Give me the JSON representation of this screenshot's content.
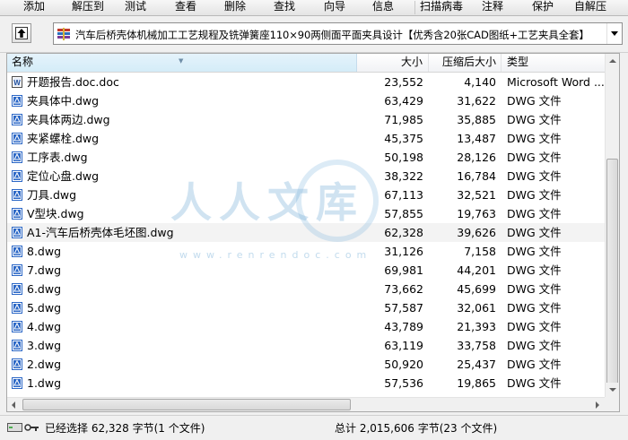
{
  "toolbar": {
    "buttons": [
      {
        "label": "添加"
      },
      {
        "label": "解压到"
      },
      {
        "label": "测试"
      },
      {
        "label": "查看"
      },
      {
        "label": "删除"
      },
      {
        "label": "查找"
      },
      {
        "label": "向导"
      },
      {
        "label": "信息"
      },
      {
        "label": "扫描病毒"
      },
      {
        "label": "注释"
      },
      {
        "label": "保护"
      },
      {
        "label": "自解压"
      }
    ]
  },
  "address": {
    "path": "汽车后桥壳体机械加工工艺规程及铣弹簧座110×90两侧面平面夹具设计【优秀含20张CAD图纸+工艺夹具全套】"
  },
  "columns": {
    "name": "名称",
    "size": "大小",
    "compressed": "压缩后大小",
    "type": "类型"
  },
  "files": [
    {
      "name": "开题报告.doc.doc",
      "size": "23,552",
      "compressed": "4,140",
      "type": "Microsoft Word ...",
      "icon": "word-doc-icon"
    },
    {
      "name": "夹具体中.dwg",
      "size": "63,429",
      "compressed": "31,622",
      "type": "DWG 文件",
      "icon": "dwg-file-icon"
    },
    {
      "name": "夹具体两边.dwg",
      "size": "71,985",
      "compressed": "35,885",
      "type": "DWG 文件",
      "icon": "dwg-file-icon"
    },
    {
      "name": "夹紧螺栓.dwg",
      "size": "45,375",
      "compressed": "13,487",
      "type": "DWG 文件",
      "icon": "dwg-file-icon"
    },
    {
      "name": "工序表.dwg",
      "size": "50,198",
      "compressed": "28,126",
      "type": "DWG 文件",
      "icon": "dwg-file-icon"
    },
    {
      "name": "定位心盘.dwg",
      "size": "38,322",
      "compressed": "16,784",
      "type": "DWG 文件",
      "icon": "dwg-file-icon"
    },
    {
      "name": "刀具.dwg",
      "size": "67,113",
      "compressed": "32,521",
      "type": "DWG 文件",
      "icon": "dwg-file-icon"
    },
    {
      "name": "V型块.dwg",
      "size": "57,855",
      "compressed": "19,763",
      "type": "DWG 文件",
      "icon": "dwg-file-icon"
    },
    {
      "name": "A1-汽车后桥壳体毛坯图.dwg",
      "size": "62,328",
      "compressed": "39,626",
      "type": "DWG 文件",
      "icon": "dwg-file-icon",
      "selected": true
    },
    {
      "name": "8.dwg",
      "size": "31,126",
      "compressed": "7,158",
      "type": "DWG 文件",
      "icon": "dwg-file-icon"
    },
    {
      "name": "7.dwg",
      "size": "69,981",
      "compressed": "44,201",
      "type": "DWG 文件",
      "icon": "dwg-file-icon"
    },
    {
      "name": "6.dwg",
      "size": "73,662",
      "compressed": "45,699",
      "type": "DWG 文件",
      "icon": "dwg-file-icon"
    },
    {
      "name": "5.dwg",
      "size": "57,587",
      "compressed": "32,061",
      "type": "DWG 文件",
      "icon": "dwg-file-icon"
    },
    {
      "name": "4.dwg",
      "size": "43,789",
      "compressed": "21,393",
      "type": "DWG 文件",
      "icon": "dwg-file-icon"
    },
    {
      "name": "3.dwg",
      "size": "63,119",
      "compressed": "33,758",
      "type": "DWG 文件",
      "icon": "dwg-file-icon"
    },
    {
      "name": "2.dwg",
      "size": "50,920",
      "compressed": "25,437",
      "type": "DWG 文件",
      "icon": "dwg-file-icon"
    },
    {
      "name": "1.dwg",
      "size": "57,536",
      "compressed": "19,865",
      "type": "DWG 文件",
      "icon": "dwg-file-icon"
    }
  ],
  "watermark": {
    "logo_text": "人人文库",
    "url": "www.renrendoc.com"
  },
  "status": {
    "selected": "已经选择 62,328 字节(1 个文件)",
    "total": "总计 2,015,606 字节(23 个文件)"
  },
  "colors": {
    "selection_row": "#f3f3f3",
    "header_sorted": "#d4ecf8",
    "dwg_icon_blue": "#2b67c6"
  }
}
